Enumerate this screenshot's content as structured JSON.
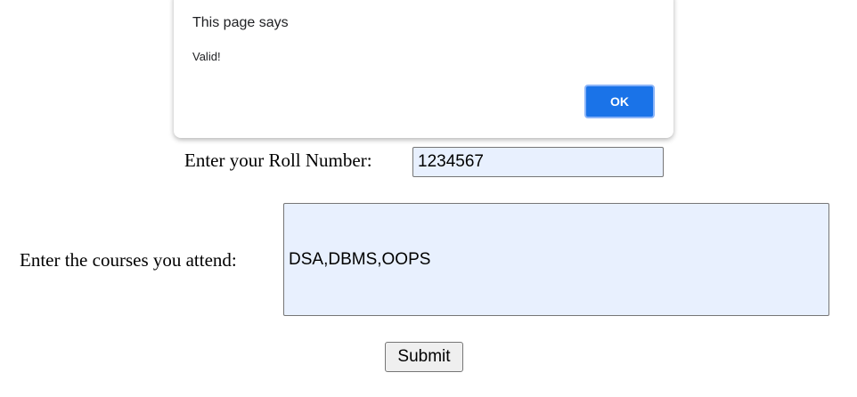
{
  "dialog": {
    "title": "This page says",
    "message": "Valid!",
    "ok_label": "OK"
  },
  "form": {
    "roll_label": "Enter your Roll Number:",
    "roll_value": "1234567",
    "courses_label": "Enter the courses you attend:",
    "courses_value": "DSA,DBMS,OOPS",
    "submit_label": "Submit"
  }
}
